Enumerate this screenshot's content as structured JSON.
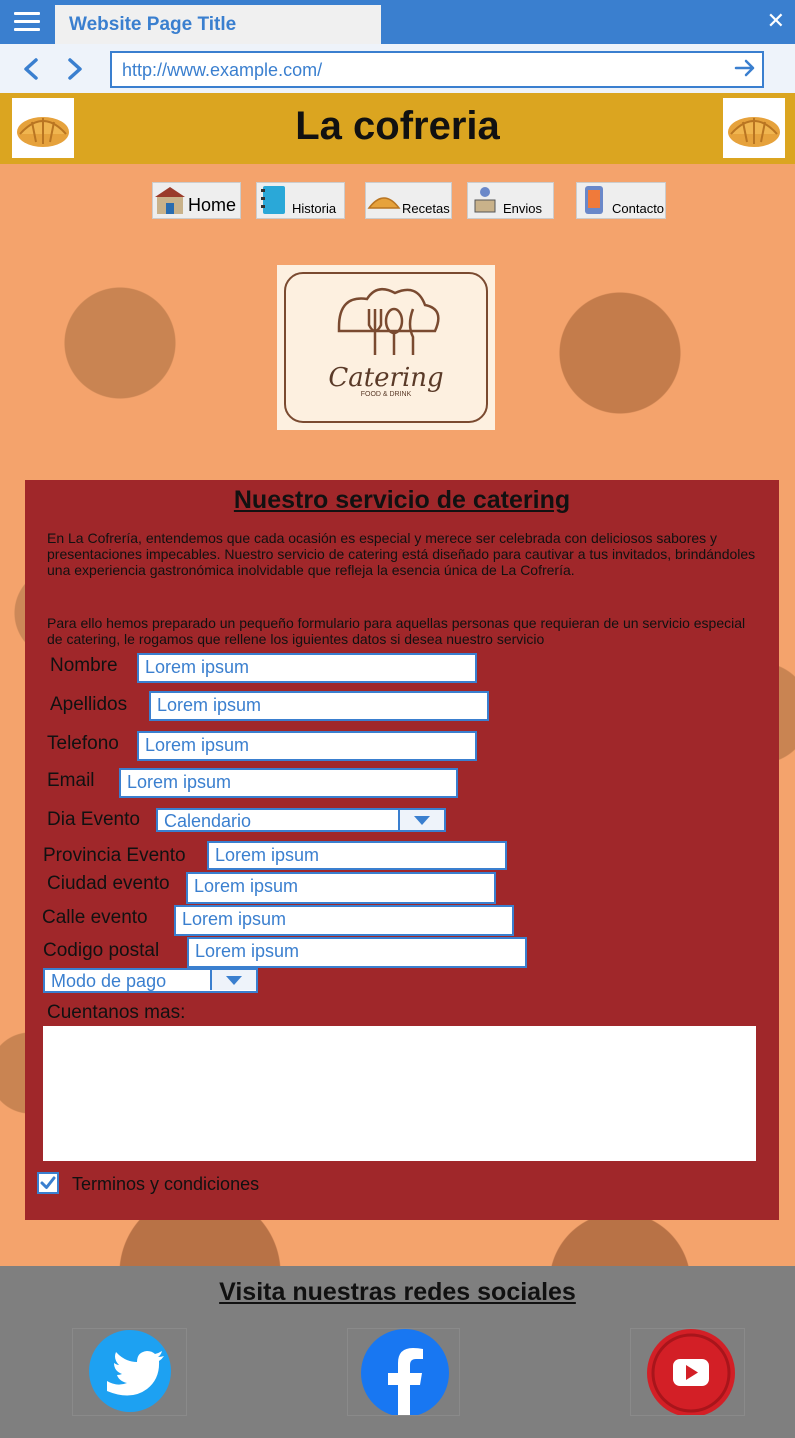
{
  "browser": {
    "tab_title": "Website Page Title",
    "url": "http://www.example.com/"
  },
  "header": {
    "site_title": "La cofreria"
  },
  "nav": {
    "items": [
      {
        "label": "Home"
      },
      {
        "label": "Historia"
      },
      {
        "label": "Recetas"
      },
      {
        "label": "Envios"
      },
      {
        "label": "Contacto"
      }
    ]
  },
  "logo": {
    "text": "Catering",
    "subtext": "FOOD & DRINK"
  },
  "form": {
    "title": "Nuestro servicio de catering",
    "intro": "En La Cofrería, entendemos que cada ocasión es especial y merece ser celebrada con deliciosos sabores y presentaciones impecables. Nuestro servicio de catering está diseñado para cautivar a tus invitados, brindándoles una experiencia gastronómica inolvidable que refleja la esencia única de La Cofrería.",
    "instructions": "Para ello hemos preparado un pequeño formulario para aquellas personas que requieran de un servicio especial de catering, le rogamos que rellene los iguientes datos si desea nuestro servicio",
    "fields": {
      "nombre": {
        "label": "Nombre",
        "value": "Lorem ipsum"
      },
      "apellidos": {
        "label": "Apellidos",
        "value": "Lorem ipsum"
      },
      "telefono": {
        "label": "Telefono",
        "value": "Lorem ipsum"
      },
      "email": {
        "label": "Email",
        "value": "Lorem ipsum"
      },
      "dia_evento": {
        "label": "Dia Evento",
        "value": "Calendario"
      },
      "provincia": {
        "label": "Provincia Evento",
        "value": "Lorem ipsum"
      },
      "ciudad": {
        "label": "Ciudad evento",
        "value": "Lorem ipsum"
      },
      "calle": {
        "label": "Calle evento",
        "value": "Lorem ipsum"
      },
      "codigo_postal": {
        "label": "Codigo postal",
        "value": "Lorem ipsum"
      },
      "modo_pago": {
        "value": "Modo de pago"
      },
      "cuentanos": {
        "label": "Cuentanos mas:",
        "value": ""
      }
    },
    "terms": {
      "label": "Terminos y condiciones",
      "checked": true
    }
  },
  "footer": {
    "title": "Visita nuestras redes sociales",
    "icons": [
      "twitter-icon",
      "facebook-icon",
      "youtube-icon"
    ]
  },
  "colors": {
    "accent": "#3a7fcf",
    "header": "#dba520",
    "panel": "#a0272a",
    "footer": "#7f7f7f"
  }
}
